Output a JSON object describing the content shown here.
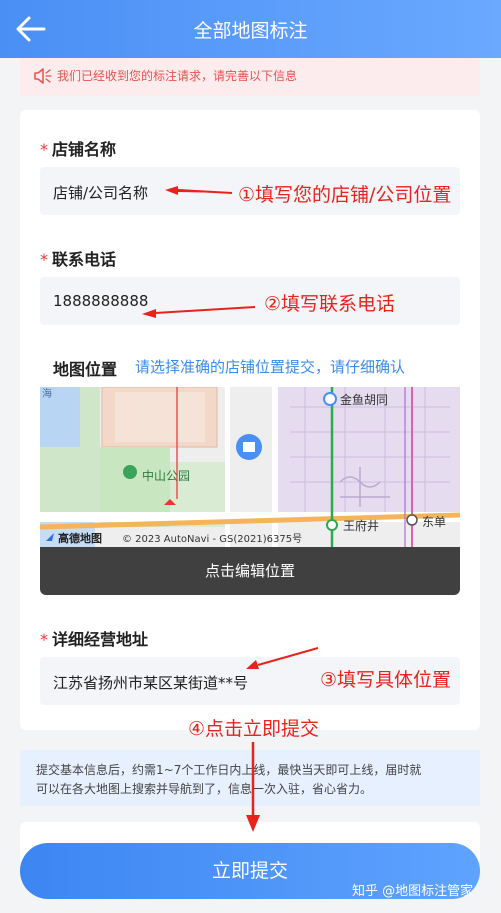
{
  "header": {
    "title": "全部地图标注"
  },
  "notice": {
    "text": "我们已经收到您的标注请求，请完善以下信息"
  },
  "form": {
    "required_mark": "*",
    "shop_name": {
      "label": "店铺名称",
      "value": "店铺/公司名称"
    },
    "phone": {
      "label": "联系电话",
      "value": "1888888888"
    },
    "map": {
      "label": "地图位置",
      "hint": "请选择准确的店铺位置提交，请仔细确认",
      "places": {
        "jinyu": "金鱼胡同",
        "zhongshan": "中山公园",
        "wangfujing": "王府井",
        "dongdan": "东单",
        "corner": "海"
      },
      "brand": "高德地图",
      "copyright": "© 2023 AutoNavi - GS(2021)6375号",
      "edit_button": "点击编辑位置"
    },
    "address": {
      "label": "详细经营地址",
      "value": "江苏省扬州市某区某街道**号"
    }
  },
  "annotations": {
    "step1": "①填写您的店铺/公司位置",
    "step2": "②填写联系电话",
    "step3": "③填写具体位置",
    "step4": "④点击立即提交"
  },
  "info": {
    "line1": "提交基本信息后，约需1~7个工作日内上线，最快当天即可上线，届时就",
    "line2": "可以在各大地图上搜索并导航到了，信息一次入驻，省心省力。"
  },
  "submit_label": "立即提交",
  "watermark": "知乎 @地图标注管家",
  "colors": {
    "brand": "#4a8ff5",
    "annotation": "#e8231c",
    "notice_text": "#e8534d",
    "hint": "#3b8ce8"
  }
}
